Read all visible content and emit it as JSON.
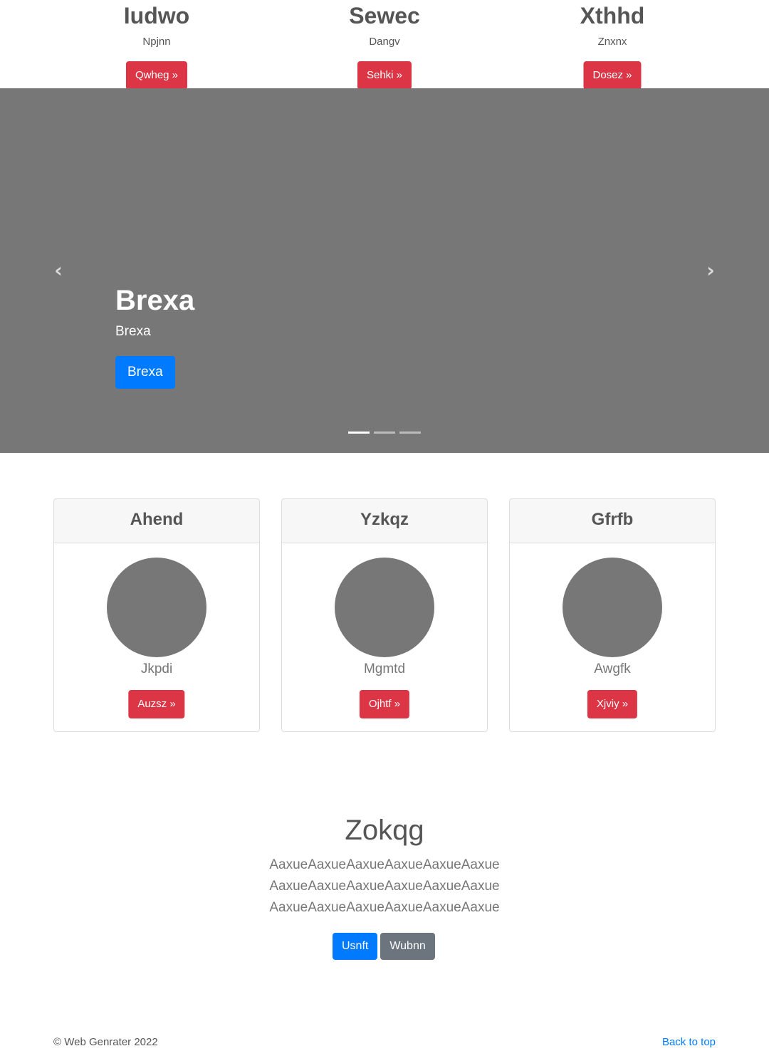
{
  "top_features": [
    {
      "title": "Iudwo",
      "subtitle": "Npjnn",
      "button": "Qwheg »"
    },
    {
      "title": "Sewec",
      "subtitle": "Dangv",
      "button": "Sehki »"
    },
    {
      "title": "Xthhd",
      "subtitle": "Znxnx",
      "button": "Dosez »"
    }
  ],
  "carousel": {
    "prev_icon": "‹",
    "next_icon": "›",
    "title": "Brexa",
    "subtitle": "Brexa",
    "button": "Brexa",
    "slide_count": 3,
    "active_slide": 1,
    "background": "#777777"
  },
  "cards": [
    {
      "header": "Ahend",
      "name": "Jkpdi",
      "button": "Auzsz »"
    },
    {
      "header": "Yzkqz",
      "name": "Mgmtd",
      "button": "Ojhtf »"
    },
    {
      "header": "Gfrfb",
      "name": "Awgfk",
      "button": "Xjviy »"
    }
  ],
  "jumbotron": {
    "title": "Zokqg",
    "lines": [
      "AaxueAaxueAaxueAaxueAaxueAaxue",
      "AaxueAaxueAaxueAaxueAaxueAaxue",
      "AaxueAaxueAaxueAaxueAaxueAaxue"
    ],
    "primary_button": "Usnft",
    "secondary_button": "Wubnn"
  },
  "footer": {
    "copyright": "© Web Genrater 2022",
    "back_to_top": "Back to top"
  },
  "colors": {
    "danger": "#dc3545",
    "primary": "#007bff",
    "secondary": "#6c757d",
    "placeholder_gray": "#777777"
  }
}
